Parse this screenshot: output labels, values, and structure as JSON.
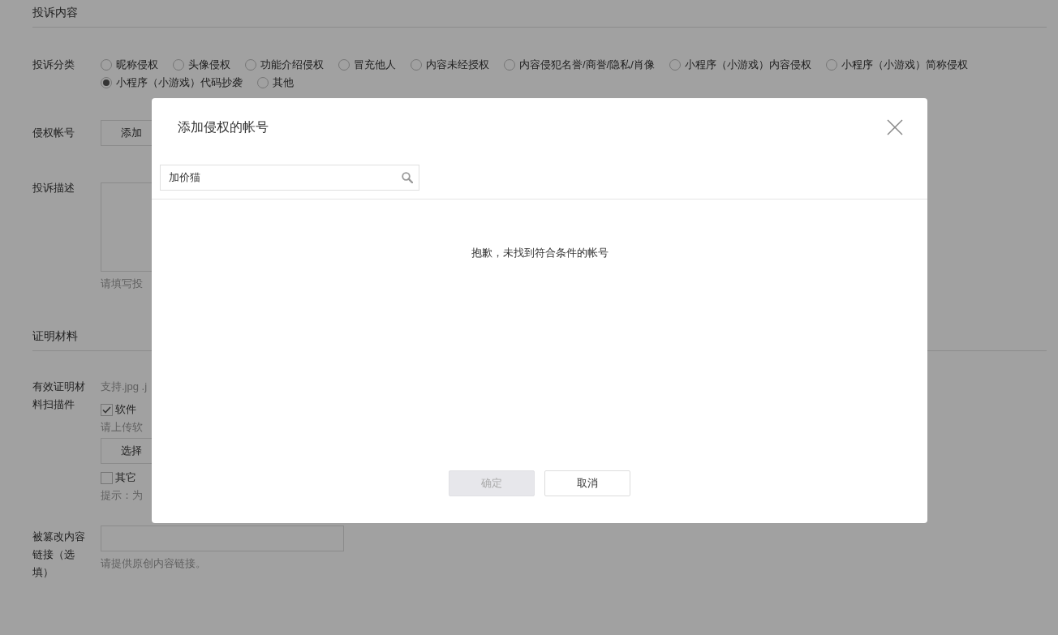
{
  "sections": [
    {
      "title": "投诉内容"
    },
    {
      "title": "证明材料"
    }
  ],
  "category": {
    "label": "投诉分类",
    "options": [
      {
        "label": "昵称侵权",
        "selected": false
      },
      {
        "label": "头像侵权",
        "selected": false
      },
      {
        "label": "功能介绍侵权",
        "selected": false
      },
      {
        "label": "冒充他人",
        "selected": false
      },
      {
        "label": "内容未经授权",
        "selected": false
      },
      {
        "label": "内容侵犯名誉/商誉/隐私/肖像",
        "selected": false
      },
      {
        "label": "小程序（小游戏）内容侵权",
        "selected": false
      },
      {
        "label": "小程序（小游戏）简称侵权",
        "selected": false
      },
      {
        "label": "小程序（小游戏）代码抄袭",
        "selected": true
      },
      {
        "label": "其他",
        "selected": false
      }
    ]
  },
  "account": {
    "label": "侵权帐号",
    "button": "添加"
  },
  "description": {
    "label": "投诉描述",
    "hint": "请填写投"
  },
  "materials": {
    "label": "有效证明材料扫描件",
    "note": "支持.jpg .j",
    "items": [
      {
        "label": "软件",
        "checked": true,
        "hint": "请上传软",
        "button": "选择"
      },
      {
        "label": "其它",
        "checked": false,
        "hint": "提示：为"
      }
    ]
  },
  "link": {
    "label": "被篡改内容链接（选填）",
    "hint": "请提供原创内容链接。"
  },
  "modal": {
    "title": "添加侵权的帐号",
    "search": {
      "value": "加价猫"
    },
    "message": "抱歉，未找到符合条件的帐号",
    "buttons": [
      {
        "label": "确定",
        "disabled": true
      },
      {
        "label": "取消",
        "disabled": false
      }
    ]
  }
}
